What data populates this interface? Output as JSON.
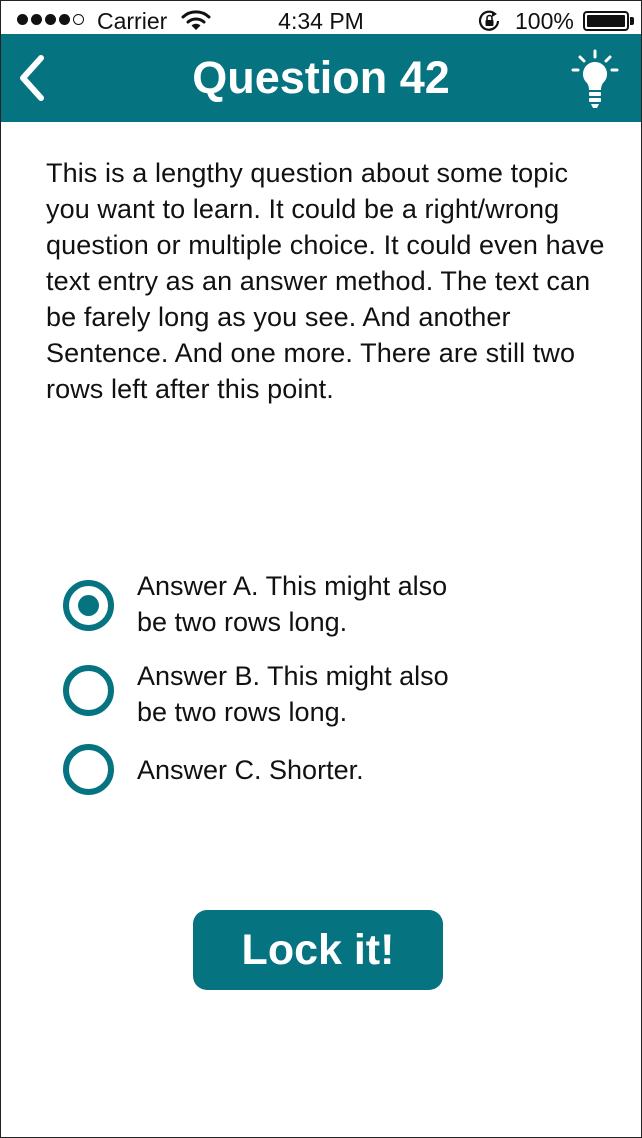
{
  "status_bar": {
    "carrier": "Carrier",
    "time": "4:34 PM",
    "battery_percent": "100%",
    "signal_bars_filled": 4,
    "signal_bars_total": 5
  },
  "nav": {
    "title": "Question 42",
    "back_icon": "chevron-left-icon",
    "hint_icon": "lightbulb-icon"
  },
  "question": {
    "text": "This is a lengthy question about some topic you want to learn. It could be a right/wrong question or multiple choice. It could even have text entry as an answer method. The text can be farely long as you see. And another Sentence. And one more. There are still two rows left after this point."
  },
  "answers": [
    {
      "label_line1": "Answer A. This might also",
      "label_line2": "be two rows long.",
      "selected": true
    },
    {
      "label_line1": "Answer B. This might also",
      "label_line2": "be two rows long.",
      "selected": false
    },
    {
      "label_line1": "Answer C. Shorter.",
      "label_line2": "",
      "selected": false
    }
  ],
  "lock_button": {
    "label": "Lock it!"
  },
  "colors": {
    "accent": "#057380",
    "text": "#111111",
    "background": "#ffffff"
  }
}
